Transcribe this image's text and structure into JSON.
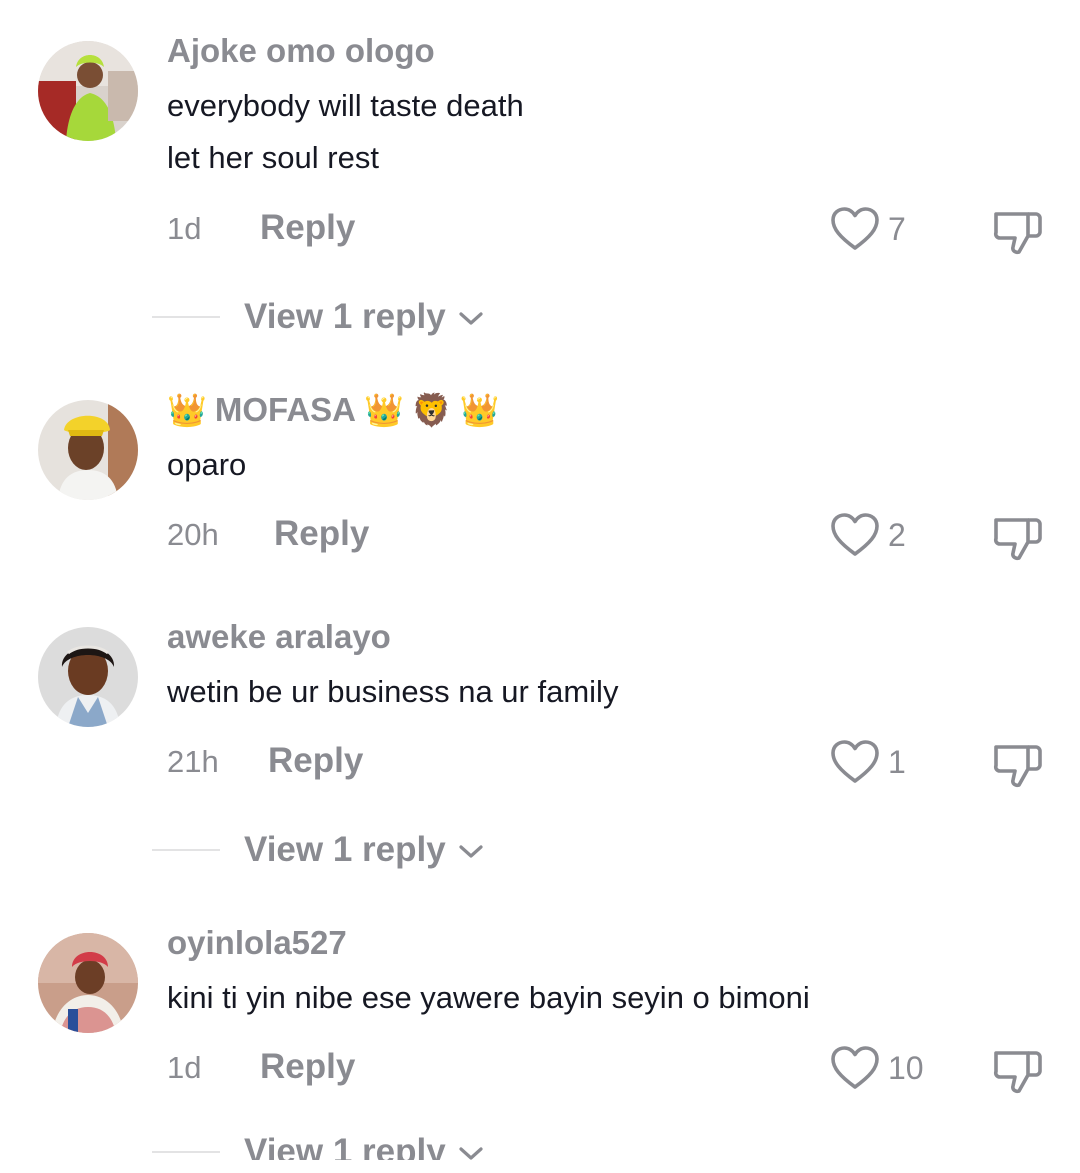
{
  "comments": [
    {
      "username": "Ajoke omo ologo",
      "lines": [
        "everybody will taste death",
        "let her soul rest"
      ],
      "time": "1d",
      "reply_label": "Reply",
      "likes": "7",
      "view_replies": "View 1 reply"
    },
    {
      "username": "MOFASA",
      "username_emoji_before": "👑",
      "username_emoji_after": [
        "👑",
        "🦁",
        "👑"
      ],
      "lines": [
        "oparo"
      ],
      "time": "20h",
      "reply_label": "Reply",
      "likes": "2"
    },
    {
      "username": "aweke aralayo",
      "lines": [
        "wetin be ur business na ur family"
      ],
      "time": "21h",
      "reply_label": "Reply",
      "likes": "1",
      "view_replies": "View 1 reply"
    },
    {
      "username": "oyinlola527",
      "lines": [
        "kini ti yin nibe ese yawere bayin seyin o bimoni"
      ],
      "time": "1d",
      "reply_label": "Reply",
      "likes": "10",
      "view_replies": "View 1 reply"
    }
  ],
  "icons": {
    "like": "heart-outline-icon",
    "dislike": "thumbs-down-outline-icon",
    "expand": "chevron-down-icon"
  },
  "colors": {
    "text_primary": "#161823",
    "text_secondary": "#8a8b91",
    "divider": "#e3e3e4"
  }
}
